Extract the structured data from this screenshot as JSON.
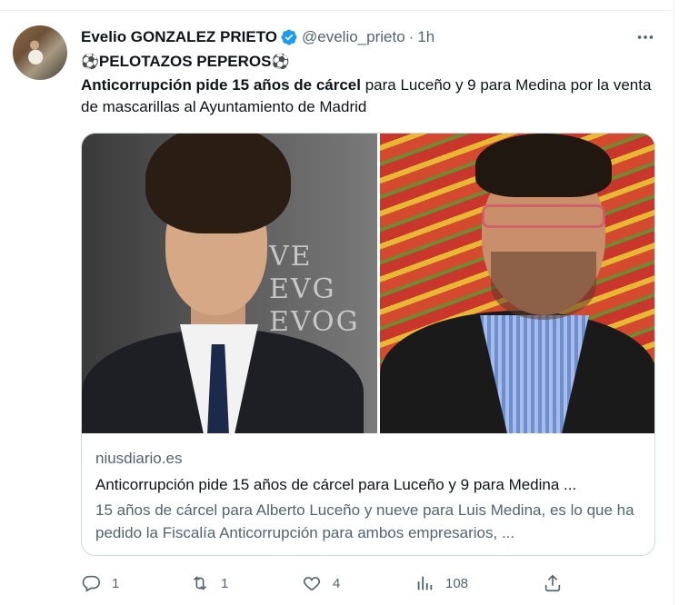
{
  "tweet": {
    "author_name": "Evelio GONZALEZ PRIETO",
    "handle": "@evelio_prieto",
    "separator": "·",
    "time": "1h",
    "line1_ball_left": "⚽",
    "line1_text": "PELOTAZOS PEPEROS",
    "line1_ball_right": "⚽",
    "line2_bold": "Anticorrupción pide 15 años de cárcel",
    "line2_rest": " para Luceño y 9 para Medina por la venta de mascarillas al Ayuntamiento de Madrid"
  },
  "card": {
    "image_text": "VE\nEVG\nEVOG",
    "domain": "niusdiario.es",
    "title": "Anticorrupción pide 15 años de cárcel para Luceño y 9 para Medina ...",
    "description": "15 años de cárcel para Alberto Luceño y nueve para Luis Medina, es lo que ha pedido la Fiscalía Anticorrupción para ambos empresarios, ..."
  },
  "actions": {
    "replies": "1",
    "retweets": "1",
    "likes": "4",
    "views": "108"
  },
  "colors": {
    "verified": "#1d9bf0",
    "muted": "#536471",
    "border": "#cfd9de"
  },
  "icons": [
    "verified-badge-icon",
    "more-icon",
    "reply-icon",
    "retweet-icon",
    "like-icon",
    "views-icon",
    "share-icon",
    "soccer-ball-icon"
  ]
}
